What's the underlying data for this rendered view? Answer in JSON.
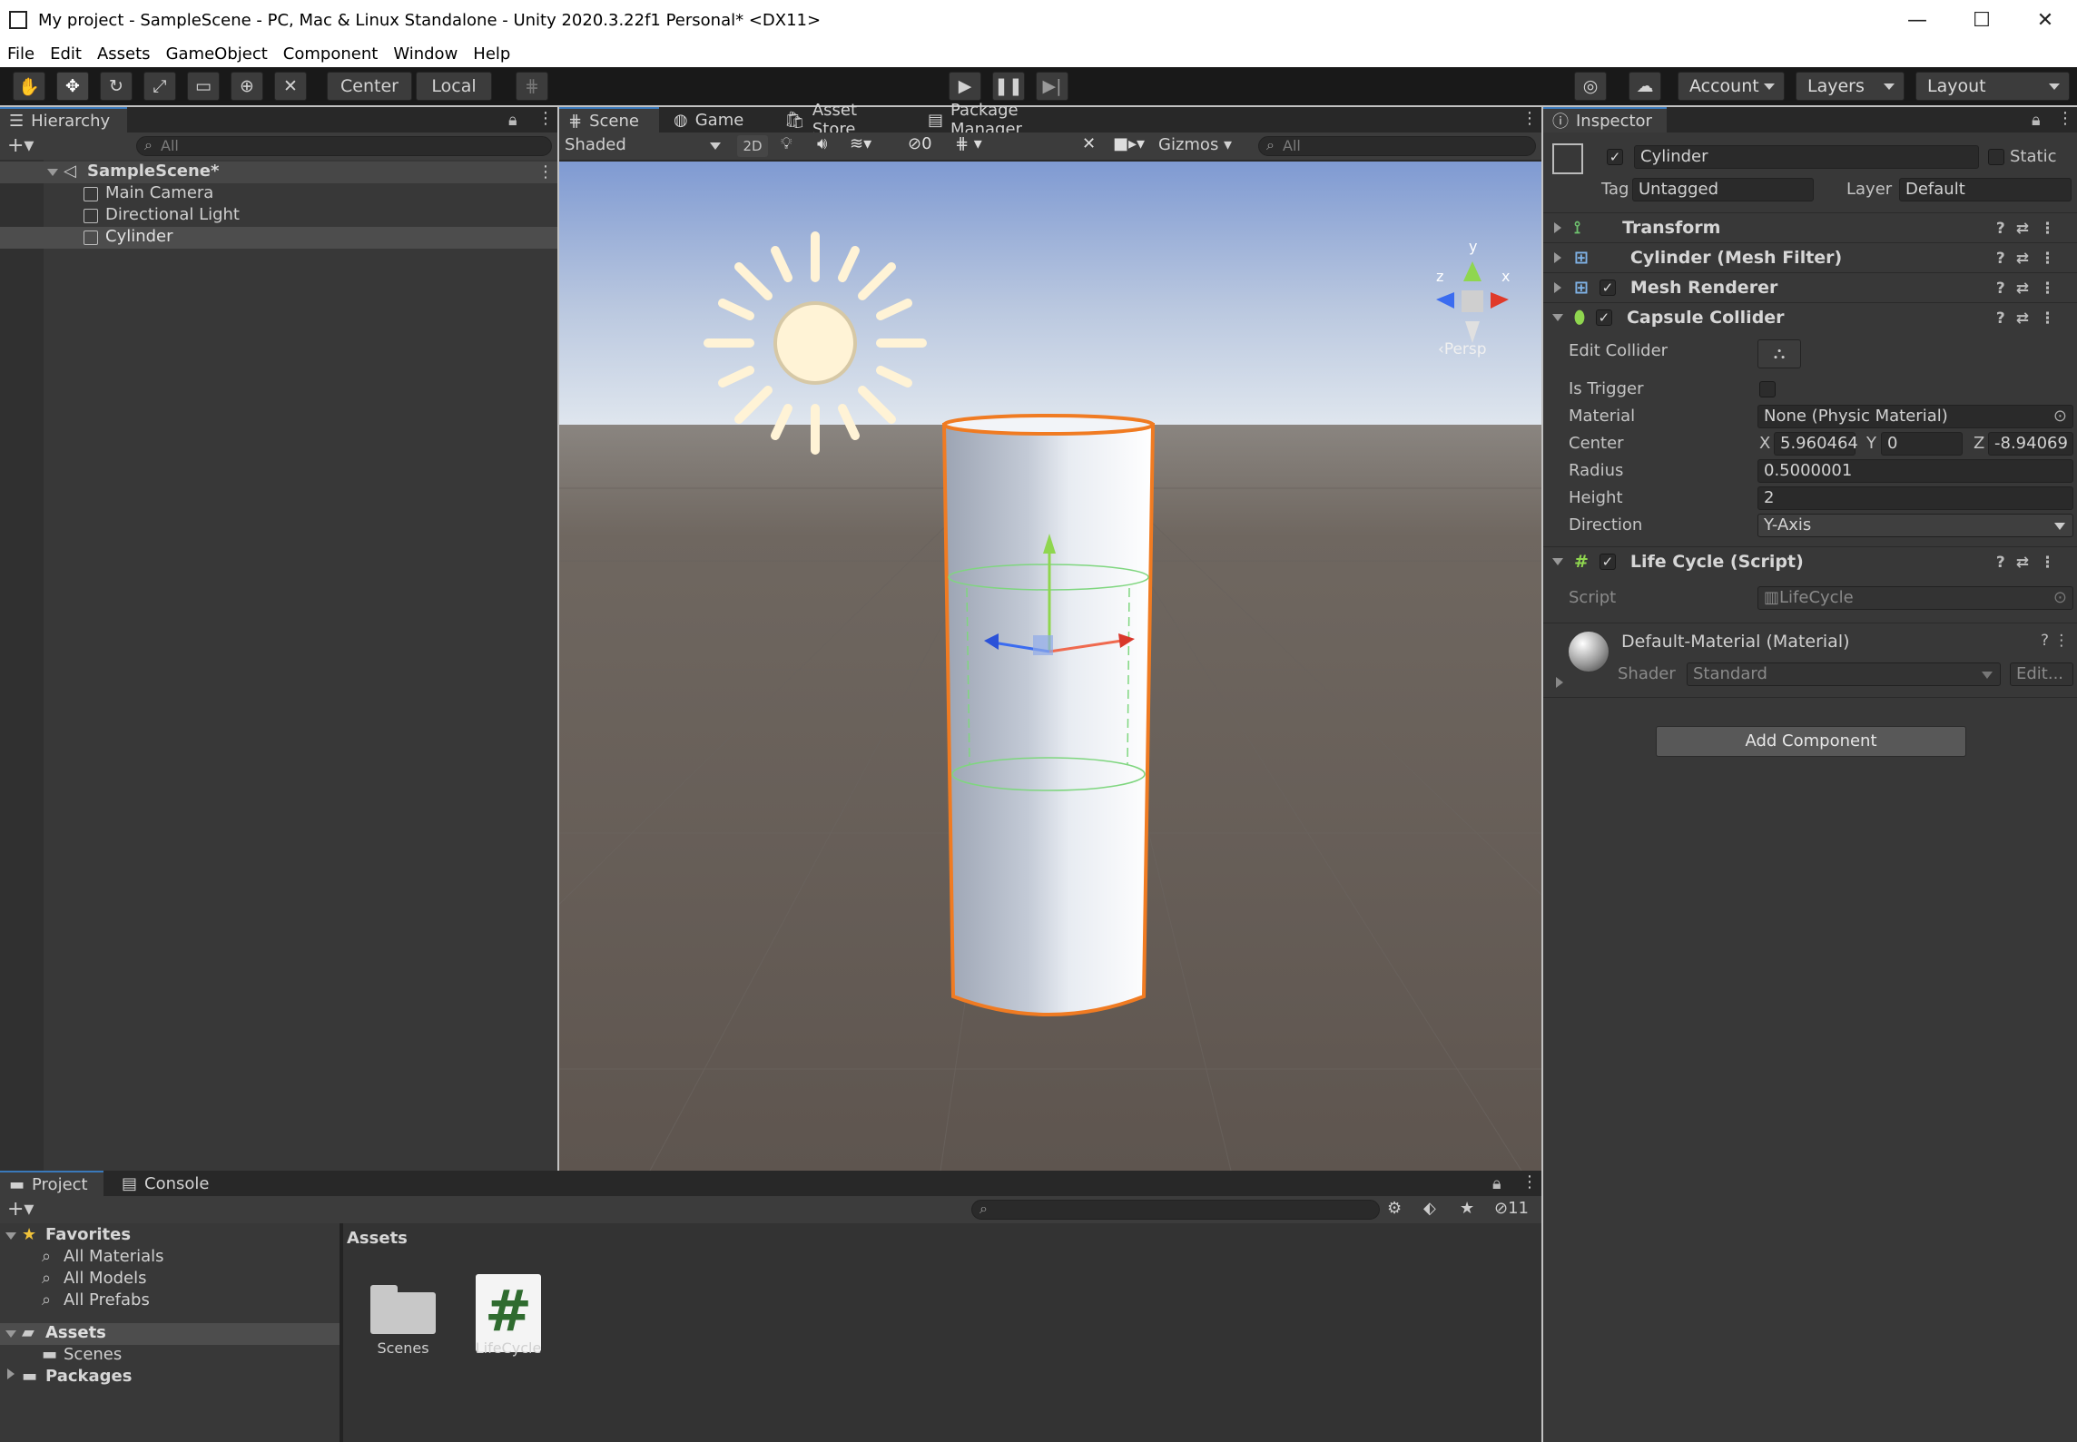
{
  "window": {
    "title": "My project - SampleScene - PC, Mac & Linux Standalone - Unity 2020.3.22f1 Personal* <DX11>",
    "minimize": "—",
    "maximize": "☐",
    "close": "✕"
  },
  "menu": [
    "File",
    "Edit",
    "Assets",
    "GameObject",
    "Component",
    "Window",
    "Help"
  ],
  "toolbar": {
    "pivot_mode": "Center",
    "pivot_rotation": "Local",
    "account": "Account",
    "layers": "Layers",
    "layout": "Layout"
  },
  "hierarchy": {
    "tab": "Hierarchy",
    "search_placeholder": "All",
    "scene": "SampleScene*",
    "items": [
      "Main Camera",
      "Directional Light",
      "Cylinder"
    ]
  },
  "scene_view": {
    "tabs": [
      "Scene",
      "Game",
      "Asset Store",
      "Package Manager"
    ],
    "shading": "Shaded",
    "mode_2d": "2D",
    "hidden_count": "0",
    "gizmos": "Gizmos",
    "search_placeholder": "All",
    "persp": "Persp",
    "axis_y": "y",
    "axis_x": "x",
    "axis_z": "z"
  },
  "inspector": {
    "tab": "Inspector",
    "object_name": "Cylinder",
    "static_label": "Static",
    "tag_label": "Tag",
    "tag_value": "Untagged",
    "layer_label": "Layer",
    "layer_value": "Default",
    "components": {
      "transform": "Transform",
      "mesh_filter": "Cylinder (Mesh Filter)",
      "mesh_renderer": "Mesh Renderer",
      "capsule_collider": "Capsule Collider",
      "life_cycle": "Life Cycle (Script)"
    },
    "collider": {
      "edit_collider": "Edit Collider",
      "is_trigger": "Is Trigger",
      "material_label": "Material",
      "material_value": "None (Physic Material)",
      "center_label": "Center",
      "center_x_label": "X",
      "center_x": "5.960464",
      "center_y_label": "Y",
      "center_y": "0",
      "center_z_label": "Z",
      "center_z": "-8.94069",
      "radius_label": "Radius",
      "radius": "0.5000001",
      "height_label": "Height",
      "height": "2",
      "direction_label": "Direction",
      "direction": "Y-Axis"
    },
    "script": {
      "label": "Script",
      "value": "LifeCycle"
    },
    "material": {
      "name": "Default-Material (Material)",
      "shader_label": "Shader",
      "shader_value": "Standard",
      "edit": "Edit..."
    },
    "add_component": "Add Component"
  },
  "project": {
    "tabs": [
      "Project",
      "Console"
    ],
    "hidden_count": "11",
    "favorites_label": "Favorites",
    "favorites": [
      "All Materials",
      "All Models",
      "All Prefabs"
    ],
    "assets_label": "Assets",
    "assets_children": [
      "Scenes"
    ],
    "packages_label": "Packages",
    "breadcrumb": "Assets",
    "grid_items": [
      "Scenes",
      "LifeCycle"
    ]
  },
  "colors": {
    "accent": "#3a79bb",
    "selection_outline": "#f07b22",
    "editor_bg": "#383838"
  }
}
